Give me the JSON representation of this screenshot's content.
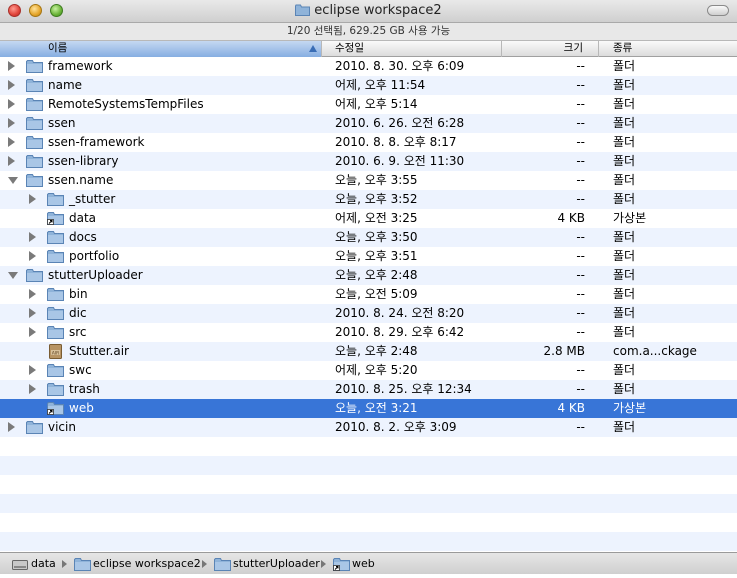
{
  "window": {
    "title": "eclipse workspace2",
    "status": "1/20 선택됨, 629.25 GB 사용 가능"
  },
  "columns": {
    "name": "이름",
    "date": "수정일",
    "size": "크기",
    "kind": "종류"
  },
  "rows": [
    {
      "name": "framework",
      "date": "2010. 8. 30. 오후 6:09",
      "size": "--",
      "kind": "폴더",
      "icon": "folder-icon",
      "disclosure": "closed",
      "indent": 0
    },
    {
      "name": "name",
      "date": "어제, 오후 11:54",
      "size": "--",
      "kind": "폴더",
      "icon": "folder-icon",
      "disclosure": "closed",
      "indent": 0
    },
    {
      "name": "RemoteSystemsTempFiles",
      "date": "어제, 오후 5:14",
      "size": "--",
      "kind": "폴더",
      "icon": "folder-icon",
      "disclosure": "closed",
      "indent": 0
    },
    {
      "name": "ssen",
      "date": "2010. 6. 26. 오전 6:28",
      "size": "--",
      "kind": "폴더",
      "icon": "folder-icon",
      "disclosure": "closed",
      "indent": 0
    },
    {
      "name": "ssen-framework",
      "date": "2010. 8. 8. 오후 8:17",
      "size": "--",
      "kind": "폴더",
      "icon": "folder-icon",
      "disclosure": "closed",
      "indent": 0
    },
    {
      "name": "ssen-library",
      "date": "2010. 6. 9. 오전 11:30",
      "size": "--",
      "kind": "폴더",
      "icon": "folder-icon",
      "disclosure": "closed",
      "indent": 0
    },
    {
      "name": "ssen.name",
      "date": "오늘, 오후 3:55",
      "size": "--",
      "kind": "폴더",
      "icon": "folder-icon",
      "disclosure": "open",
      "indent": 0
    },
    {
      "name": "_stutter",
      "date": "오늘, 오후 3:52",
      "size": "--",
      "kind": "폴더",
      "icon": "folder-icon",
      "disclosure": "closed",
      "indent": 1
    },
    {
      "name": "data",
      "date": "어제, 오전 3:25",
      "size": "4 KB",
      "kind": "가상본",
      "icon": "alias-folder-icon",
      "disclosure": "none",
      "indent": 1
    },
    {
      "name": "docs",
      "date": "오늘, 오후 3:50",
      "size": "--",
      "kind": "폴더",
      "icon": "folder-icon",
      "disclosure": "closed",
      "indent": 1
    },
    {
      "name": "portfolio",
      "date": "오늘, 오후 3:51",
      "size": "--",
      "kind": "폴더",
      "icon": "folder-icon",
      "disclosure": "closed",
      "indent": 1
    },
    {
      "name": "stutterUploader",
      "date": "오늘, 오후 2:48",
      "size": "--",
      "kind": "폴더",
      "icon": "folder-icon",
      "disclosure": "open",
      "indent": 0
    },
    {
      "name": "bin",
      "date": "오늘, 오전 5:09",
      "size": "--",
      "kind": "폴더",
      "icon": "folder-icon",
      "disclosure": "closed",
      "indent": 1
    },
    {
      "name": "dic",
      "date": "2010. 8. 24. 오전 8:20",
      "size": "--",
      "kind": "폴더",
      "icon": "folder-icon",
      "disclosure": "closed",
      "indent": 1
    },
    {
      "name": "src",
      "date": "2010. 8. 29. 오후 6:42",
      "size": "--",
      "kind": "폴더",
      "icon": "folder-icon",
      "disclosure": "closed",
      "indent": 1
    },
    {
      "name": "Stutter.air",
      "date": "오늘, 오후 2:48",
      "size": "2.8 MB",
      "kind": "com.a...ckage",
      "icon": "air-package-icon",
      "disclosure": "none",
      "indent": 1
    },
    {
      "name": "swc",
      "date": "어제, 오후 5:20",
      "size": "--",
      "kind": "폴더",
      "icon": "folder-icon",
      "disclosure": "closed",
      "indent": 1
    },
    {
      "name": "trash",
      "date": "2010. 8. 25. 오후 12:34",
      "size": "--",
      "kind": "폴더",
      "icon": "folder-icon",
      "disclosure": "closed",
      "indent": 1
    },
    {
      "name": "web",
      "date": "오늘, 오전 3:21",
      "size": "4 KB",
      "kind": "가상본",
      "icon": "alias-folder-icon",
      "disclosure": "none",
      "indent": 1,
      "selected": true
    },
    {
      "name": "vicin",
      "date": "2010. 8. 2. 오후 3:09",
      "size": "--",
      "kind": "폴더",
      "icon": "folder-icon",
      "disclosure": "closed",
      "indent": 0
    }
  ],
  "pathbar": [
    {
      "label": "data",
      "icon": "hard-drive-icon"
    },
    {
      "label": "eclipse workspace2",
      "icon": "folder-icon"
    },
    {
      "label": "stutterUploader",
      "icon": "folder-icon"
    },
    {
      "label": "web",
      "icon": "alias-folder-icon"
    }
  ],
  "colors": {
    "selection": "#3875d7",
    "stripe": "#edf3fe",
    "folder": "#8fb3d9"
  }
}
